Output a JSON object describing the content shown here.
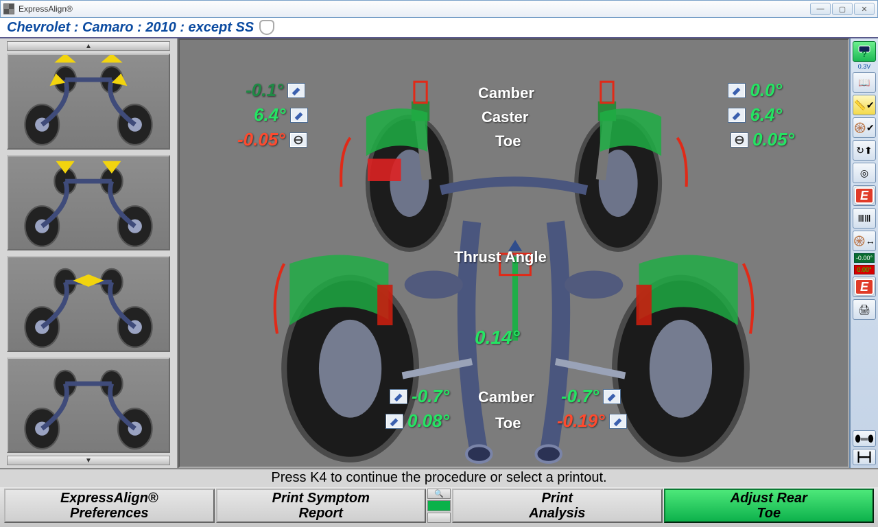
{
  "window": {
    "title": "ExpressAlign®"
  },
  "vehicle": "Chevrolet : Camaro : 2010 : except SS",
  "labels": {
    "camber": "Camber",
    "caster": "Caster",
    "toe": "Toe",
    "thrust": "Thrust Angle"
  },
  "front": {
    "left": {
      "camber": "-0.1°",
      "caster": "6.4°",
      "toe": "-0.05°",
      "camber_ok": false,
      "caster_ok": true,
      "toe_ok": false
    },
    "right": {
      "camber": "0.0°",
      "caster": "6.4°",
      "toe": "0.05°",
      "camber_ok": true,
      "caster_ok": true,
      "toe_ok": true
    }
  },
  "thrust_angle": "0.14°",
  "rear": {
    "left": {
      "camber": "-0.7°",
      "toe": "0.08°",
      "camber_ok": true,
      "toe_ok": true
    },
    "right": {
      "camber": "-0.7°",
      "toe": "-0.19°",
      "camber_ok": true,
      "toe_ok": false
    }
  },
  "status": "Press K4 to continue the procedure or select a printout.",
  "buttons": {
    "prefs": "ExpressAlign®\nPreferences",
    "symptom": "Print Symptom\nReport",
    "analysis": "Print\nAnalysis",
    "adjust": "Adjust Rear\nToe"
  },
  "toolstrip": {
    "voltage": "0.3V",
    "neg_reading": "-0.00°",
    "pos_reading": "0.00°"
  },
  "icons": {
    "wrench": "wrench",
    "steering": "steering",
    "e_badge": "E"
  }
}
